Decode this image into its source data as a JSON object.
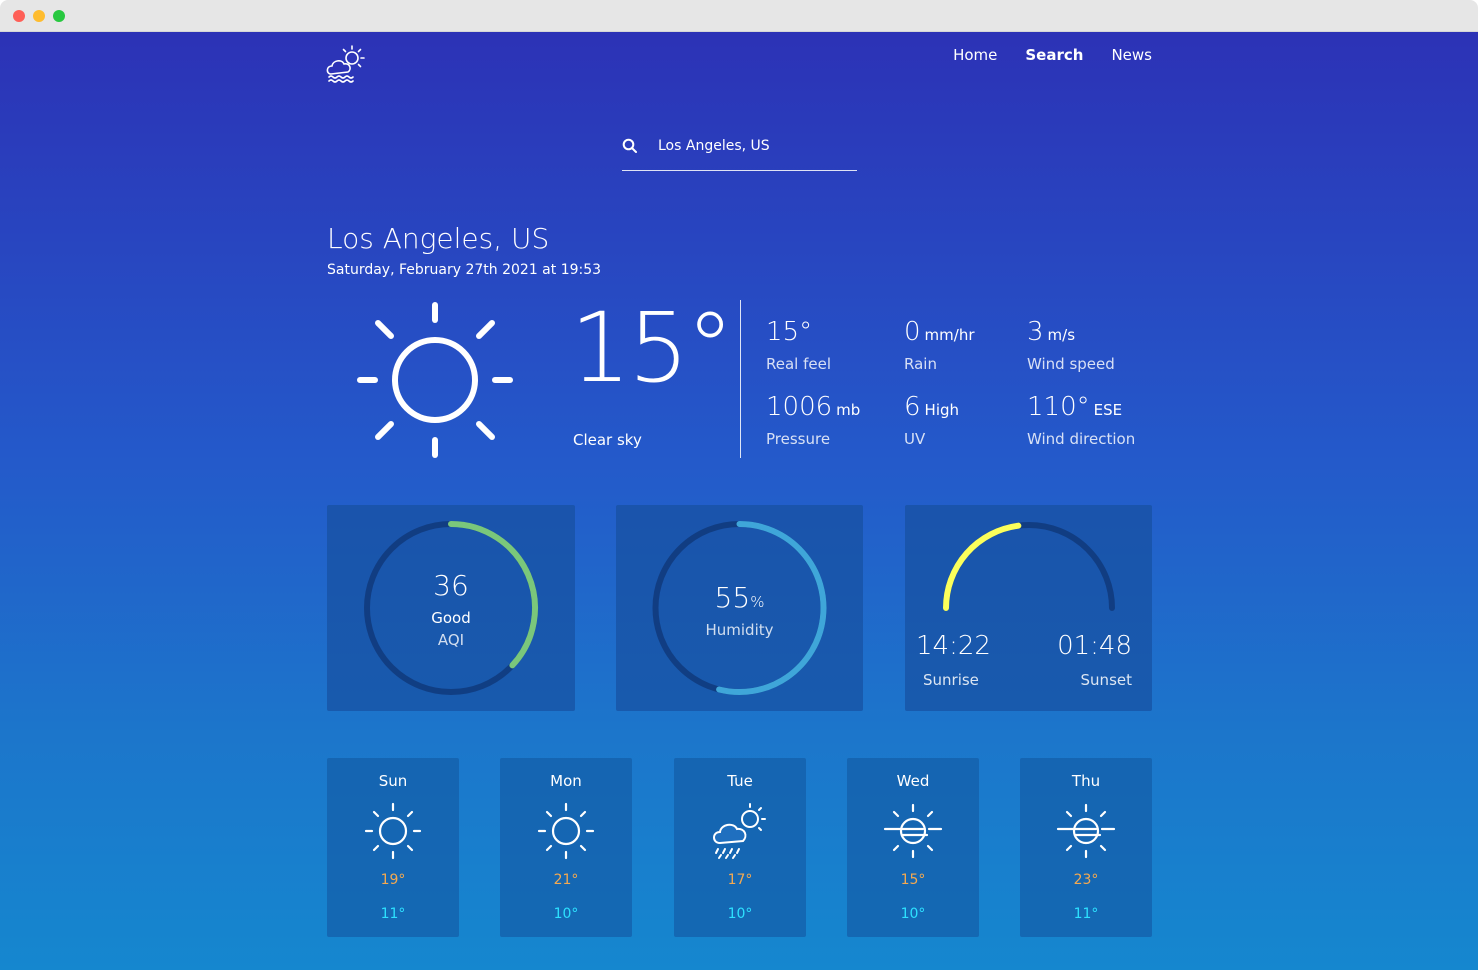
{
  "colors": {
    "aqi_arc": "#7ac77b",
    "humidity_arc": "#3fa6d9",
    "sun_arc": "#fbff5b",
    "temp_high": "#f4a950",
    "temp_low": "#2de1ff"
  },
  "nav": {
    "items": [
      "Home",
      "Search",
      "News"
    ],
    "active": "Search"
  },
  "search": {
    "value": "Los Angeles, US",
    "icon": "search-icon"
  },
  "location": {
    "city": "Los Angeles, US",
    "datetime": "Saturday, February 27th 2021 at 19:53"
  },
  "current": {
    "temp": "15°",
    "condition": "Clear sky",
    "icon": "sun-icon",
    "stats": {
      "real_feel": {
        "value": "15°",
        "unit": "",
        "label": "Real feel"
      },
      "rain": {
        "value": "0",
        "unit": "mm/hr",
        "label": "Rain"
      },
      "wind_speed": {
        "value": "3",
        "unit": "m/s",
        "label": "Wind speed"
      },
      "pressure": {
        "value": "1006",
        "unit": "mb",
        "label": "Pressure"
      },
      "uv": {
        "value": "6",
        "unit": "High",
        "label": "UV"
      },
      "wind_direction": {
        "value": "110°",
        "unit": "ESE",
        "label": "Wind direction"
      }
    }
  },
  "aqi": {
    "value": "36",
    "status": "Good",
    "label": "AQI",
    "gauge_fraction": 0.33
  },
  "humidity": {
    "value": "55",
    "unit": "%",
    "label": "Humidity",
    "percent": 55
  },
  "sun": {
    "sunrise": "14:22",
    "sunrise_label": "Sunrise",
    "sunset": "01:48",
    "sunset_label": "Sunset",
    "arc_fraction": 0.45
  },
  "forecast": [
    {
      "day": "Sun",
      "icon": "sun-icon",
      "high": "19°",
      "low": "11°"
    },
    {
      "day": "Mon",
      "icon": "sun-icon",
      "high": "21°",
      "low": "10°"
    },
    {
      "day": "Tue",
      "icon": "sun-cloud-rain-icon",
      "high": "17°",
      "low": "10°"
    },
    {
      "day": "Wed",
      "icon": "sun-haze-icon",
      "high": "15°",
      "low": "10°"
    },
    {
      "day": "Thu",
      "icon": "sun-haze-icon",
      "high": "23°",
      "low": "11°"
    }
  ]
}
